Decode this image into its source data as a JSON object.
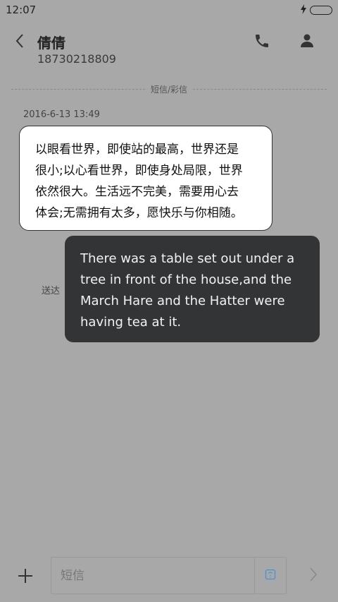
{
  "status_bar": {
    "time": "12:07"
  },
  "header": {
    "contact_name": "倩倩",
    "phone_number": "18730218809"
  },
  "thread": {
    "divider_label": "短信/彩信",
    "timestamp": "2016-6-13 13:49",
    "messages": [
      {
        "direction": "incoming",
        "lines": [
          "以眼看世界，即使站的最高，世界还是",
          "很小;以心看世界，即使身处局限，世界",
          "依然很大。生活远不完美，需要用心去",
          "体会;无需拥有太多，愿快乐与你相随。"
        ]
      },
      {
        "direction": "outgoing",
        "status": "送达",
        "lines": [
          "There was a table set out under a",
          "tree in front of the house,and the",
          "March Hare and the Hatter were",
          "having tea at it."
        ]
      }
    ]
  },
  "composer": {
    "placeholder": "短信"
  },
  "icons": {
    "back": "chevron-left-icon",
    "call": "phone-icon",
    "contact": "person-icon",
    "add": "plus-icon",
    "emoji": "emoji-icon",
    "send": "chevron-right-icon",
    "charging": "lightning-icon",
    "battery": "battery-icon"
  },
  "colors": {
    "background": "#a8a8a8",
    "incoming_bubble": "#ffffff",
    "outgoing_bubble": "#333435",
    "emoji_accent": "#4a90d9"
  }
}
